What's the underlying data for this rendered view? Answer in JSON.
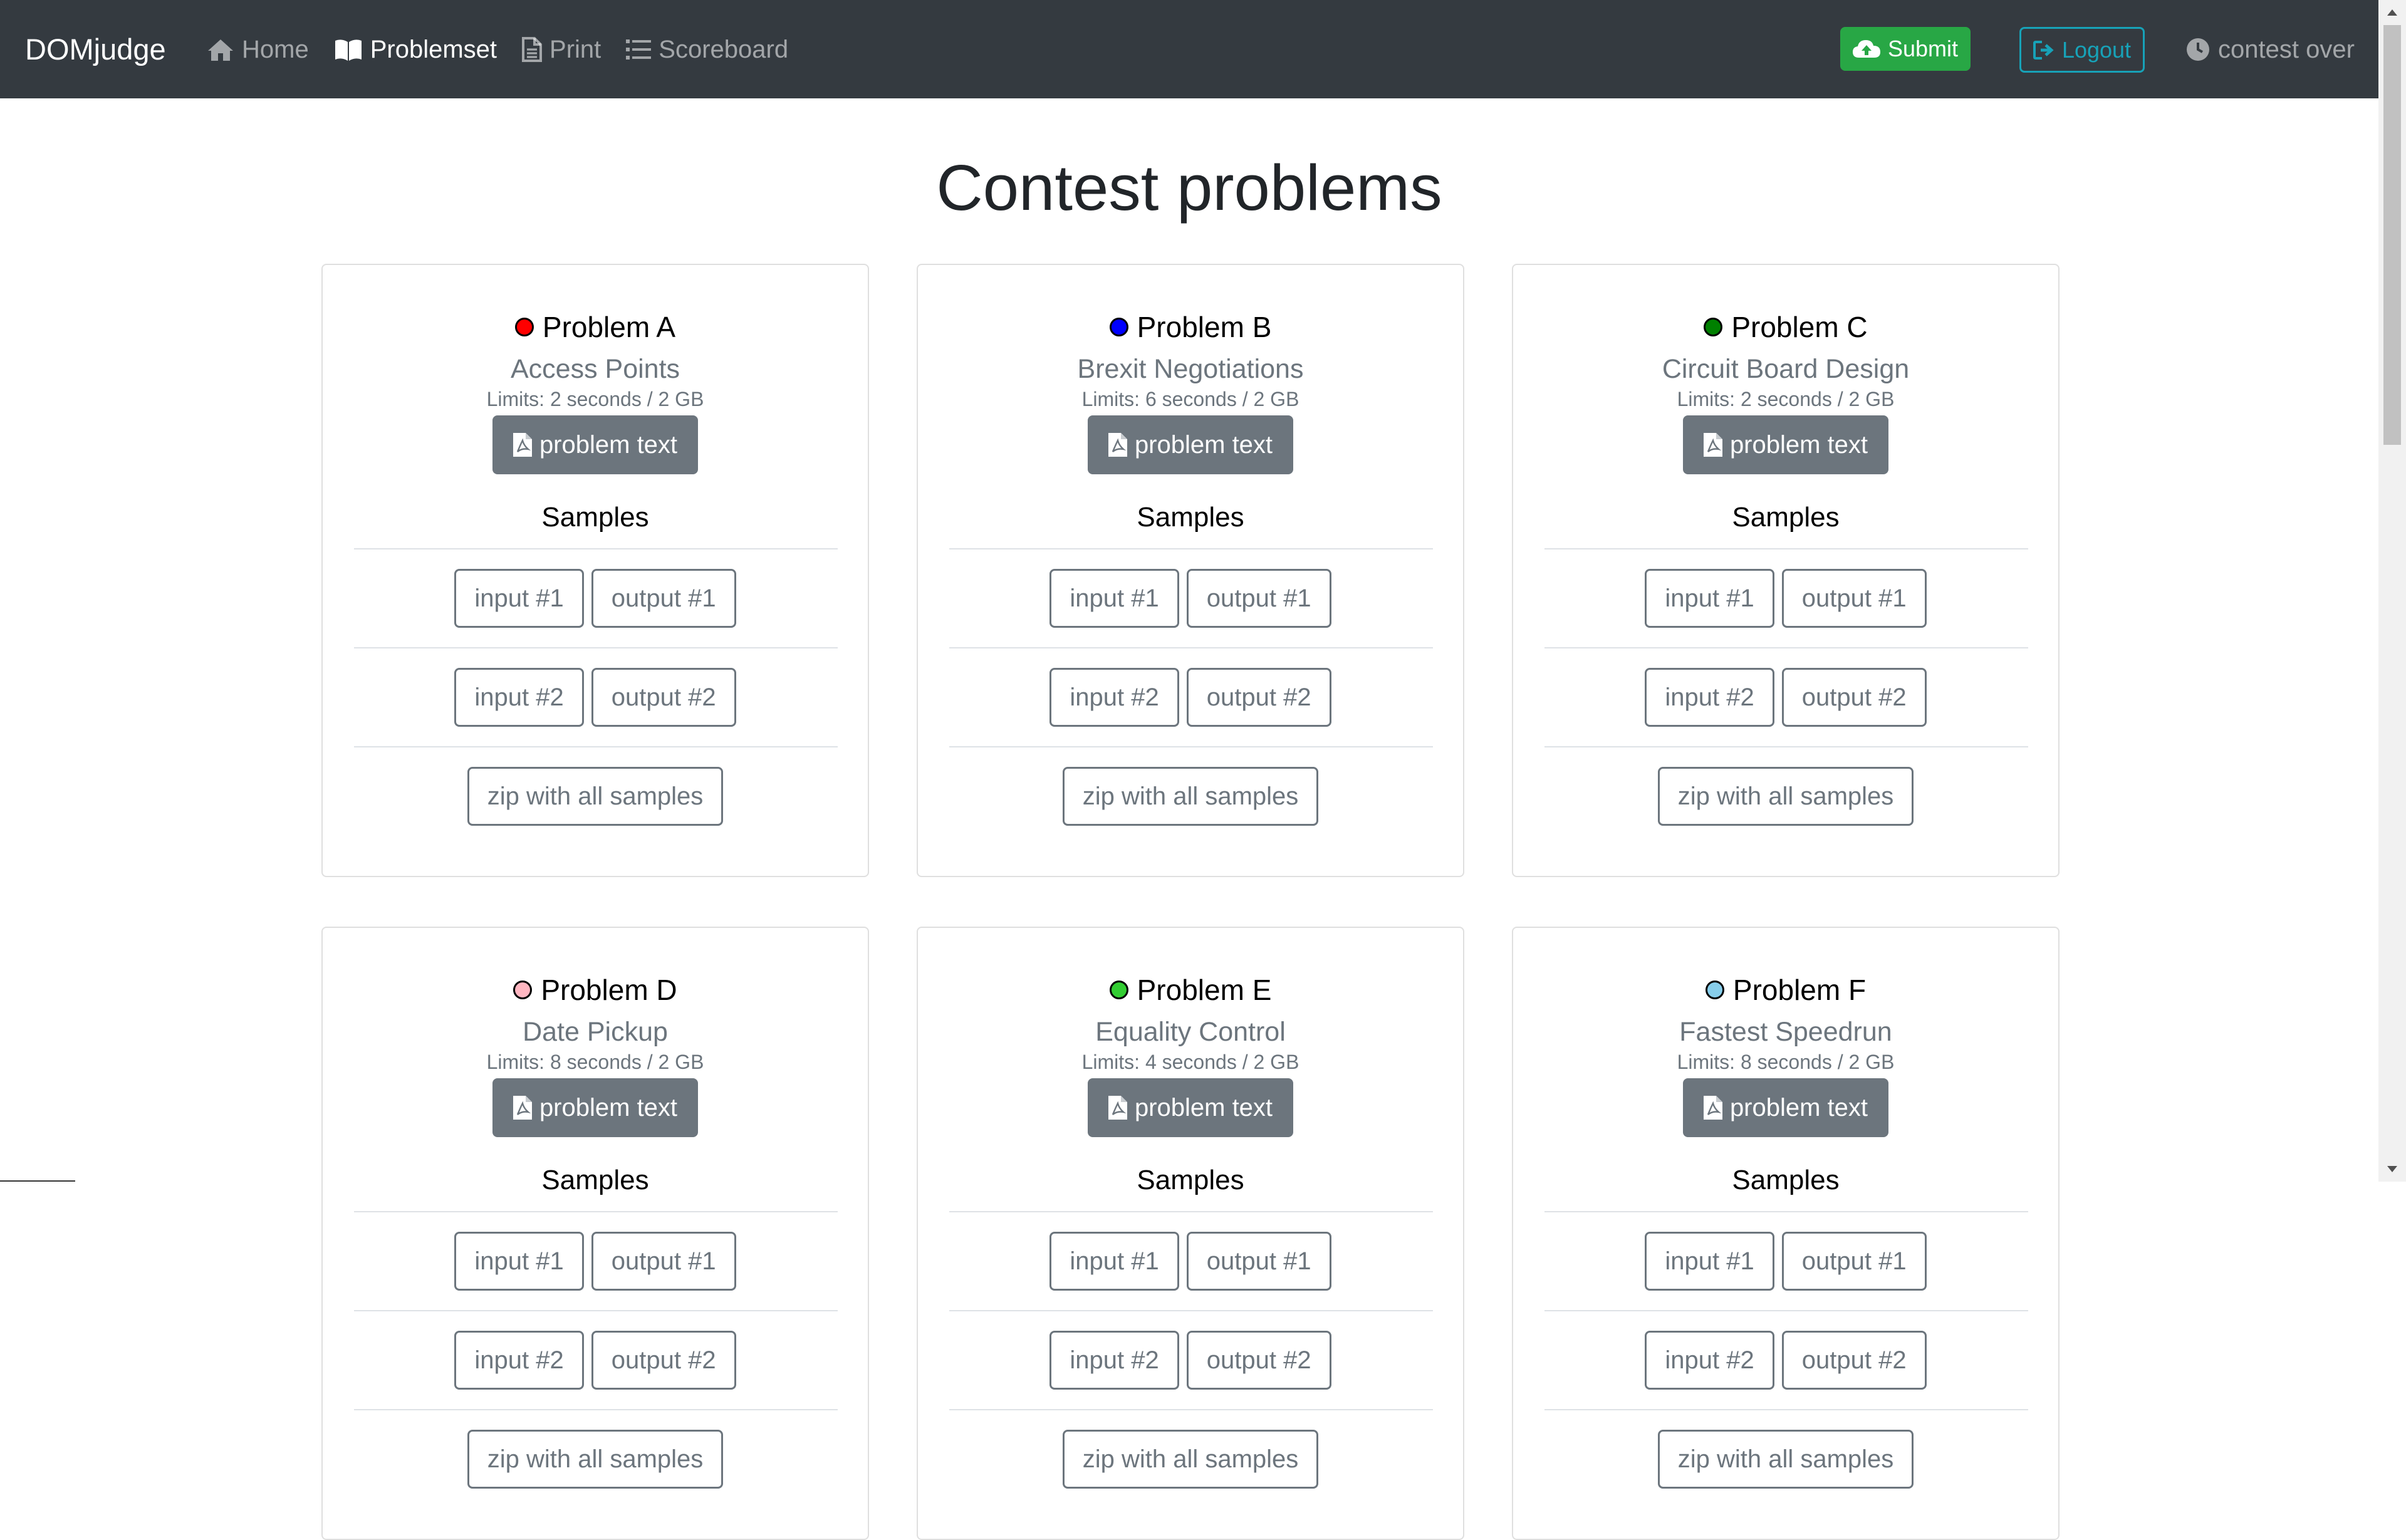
{
  "navbar": {
    "brand": "DOMjudge",
    "links": [
      {
        "label": "Home",
        "icon": "home-icon"
      },
      {
        "label": "Problemset",
        "icon": "book-icon",
        "active": true
      },
      {
        "label": "Print",
        "icon": "file-icon"
      },
      {
        "label": "Scoreboard",
        "icon": "list-icon"
      }
    ],
    "submit_label": "Submit",
    "logout_label": "Logout",
    "status": "contest over"
  },
  "page": {
    "title": "Contest problems"
  },
  "problems": [
    {
      "label": "Problem A",
      "name": "Access Points",
      "limits": "Limits: 2 seconds / 2 GB",
      "color": "#ff0000"
    },
    {
      "label": "Problem B",
      "name": "Brexit Negotiations",
      "limits": "Limits: 6 seconds / 2 GB",
      "color": "#0000ff"
    },
    {
      "label": "Problem C",
      "name": "Circuit Board Design",
      "limits": "Limits: 2 seconds / 2 GB",
      "color": "#008000"
    },
    {
      "label": "Problem D",
      "name": "Date Pickup",
      "limits": "Limits: 8 seconds / 2 GB",
      "color": "#ffb6c1"
    },
    {
      "label": "Problem E",
      "name": "Equality Control",
      "limits": "Limits: 4 seconds / 2 GB",
      "color": "#32cd32"
    },
    {
      "label": "Problem F",
      "name": "Fastest Speedrun",
      "limits": "Limits: 8 seconds / 2 GB",
      "color": "#87ceeb"
    }
  ],
  "card": {
    "problem_text_label": "problem text",
    "samples_heading": "Samples",
    "input1": "input #1",
    "output1": "output #1",
    "input2": "input #2",
    "output2": "output #2",
    "zip_label": "zip with all samples"
  }
}
